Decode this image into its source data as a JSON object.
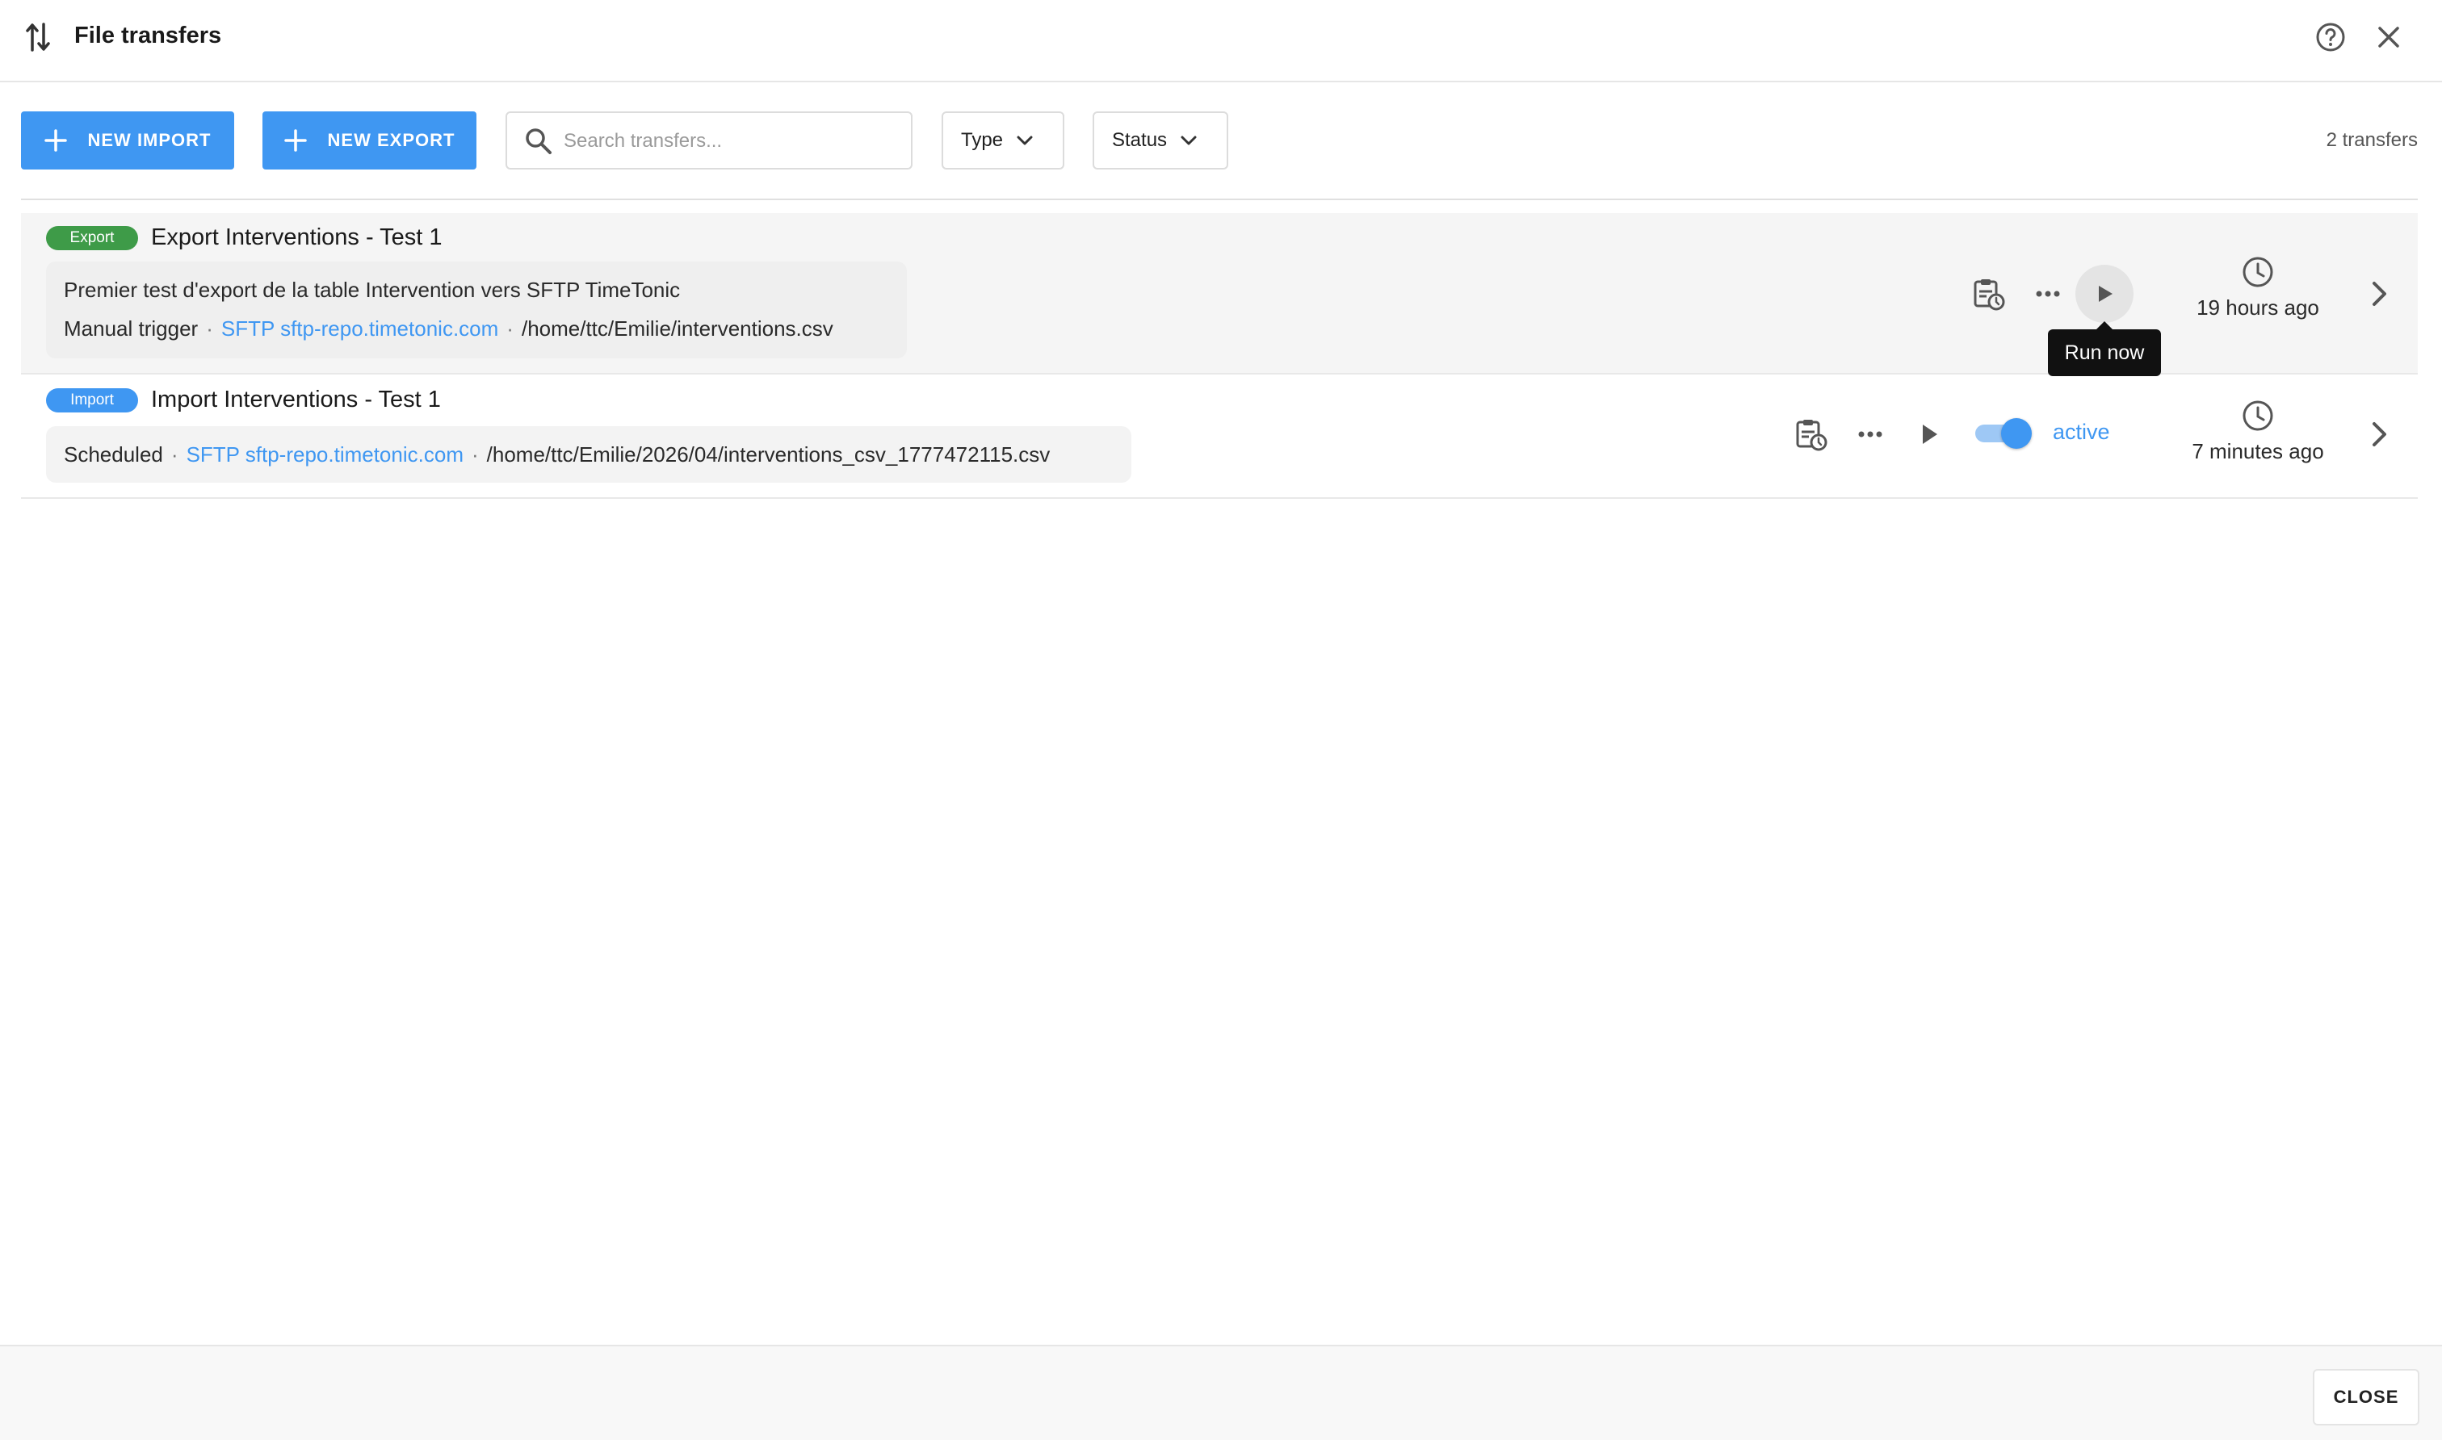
{
  "header": {
    "title": "File transfers"
  },
  "toolbar": {
    "new_import_label": "NEW IMPORT",
    "new_export_label": "NEW EXPORT",
    "search_placeholder": "Search transfers...",
    "search_value": "",
    "type_filter_label": "Type",
    "status_filter_label": "Status",
    "count_text": "2 transfers"
  },
  "transfers": [
    {
      "badge": "Export",
      "badge_color": "#3e9b48",
      "name": "Export Interventions - Test 1",
      "description": "Premier test d'export de la table Intervention vers SFTP TimeTonic",
      "trigger": "Manual trigger",
      "connection": "SFTP sftp-repo.timetonic.com",
      "path": "/home/ttc/Emilie/interventions.csv",
      "last_run": "19 hours ago",
      "tooltip": "Run now"
    },
    {
      "badge": "Import",
      "badge_color": "#3f97f2",
      "name": "Import Interventions - Test 1",
      "trigger": "Scheduled",
      "connection": "SFTP sftp-repo.timetonic.com",
      "path": "/home/ttc/Emilie/2026/04/interventions_csv_1777472115.csv",
      "active_label": "active",
      "active": true,
      "last_run": "7 minutes ago"
    }
  ],
  "footer": {
    "close_label": "CLOSE"
  },
  "colors": {
    "accent": "#3f97f2",
    "export_badge": "#3e9b48",
    "import_badge": "#3f97f2"
  },
  "icons": {
    "header": [
      "transfer-arrows-icon",
      "help-icon",
      "close-icon"
    ],
    "row_actions": [
      "schedule-clipboard-icon",
      "more-icon",
      "play-icon",
      "clock-icon",
      "chevron-right-icon"
    ]
  }
}
